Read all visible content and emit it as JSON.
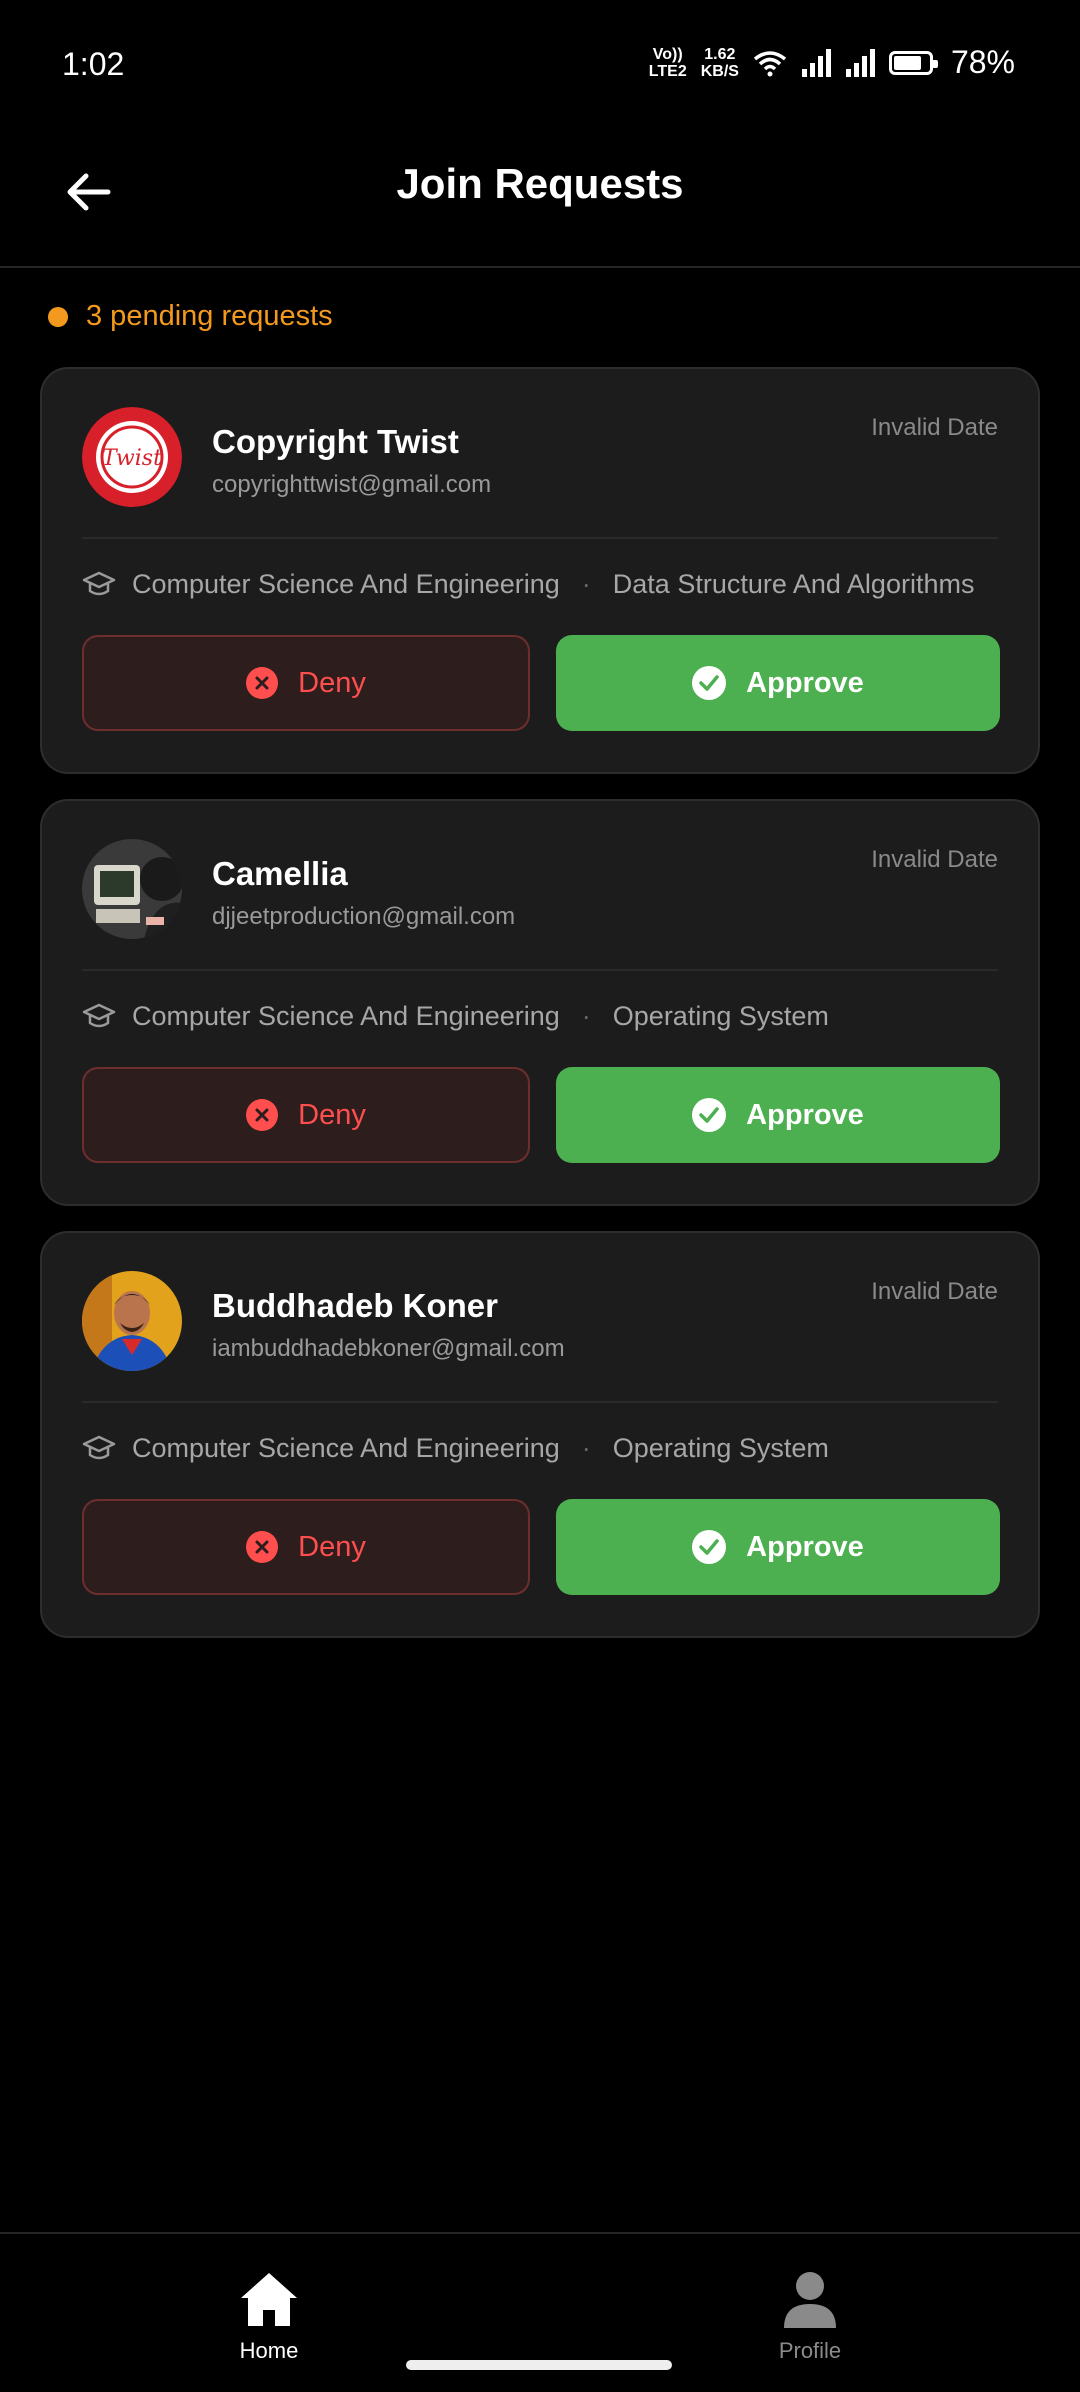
{
  "status_bar": {
    "time": "1:02",
    "volte_line1": "Vo))",
    "volte_line2": "LTE2",
    "speed_line1": "1.62",
    "speed_line2": "KB/S",
    "battery": "78%"
  },
  "header": {
    "title": "Join Requests"
  },
  "pending": {
    "text": "3 pending requests",
    "color": "#f39a1e"
  },
  "requests": [
    {
      "name": "Copyright Twist",
      "email": "copyrighttwist@gmail.com",
      "date": "Invalid Date",
      "department": "Computer Science And Engineering",
      "separator": "·",
      "course": "Data Structure And Algorithms",
      "avatar_text": "Twist"
    },
    {
      "name": "Camellia",
      "email": "djjeetproduction@gmail.com",
      "date": "Invalid Date",
      "department": "Computer Science And Engineering",
      "separator": "·",
      "course": "Operating System"
    },
    {
      "name": "Buddhadeb Koner",
      "email": "iambuddhadebkoner@gmail.com",
      "date": "Invalid Date",
      "department": "Computer Science And Engineering",
      "separator": "·",
      "course": "Operating System"
    }
  ],
  "actions": {
    "deny_label": "Deny",
    "approve_label": "Approve"
  },
  "colors": {
    "approve": "#4caf50",
    "deny": "#ff4e4e",
    "accent": "#f39a1e"
  },
  "bottom_nav": [
    {
      "label": "Home",
      "icon": "home-icon",
      "active": true
    },
    {
      "label": "Profile",
      "icon": "person-icon",
      "active": false
    }
  ]
}
